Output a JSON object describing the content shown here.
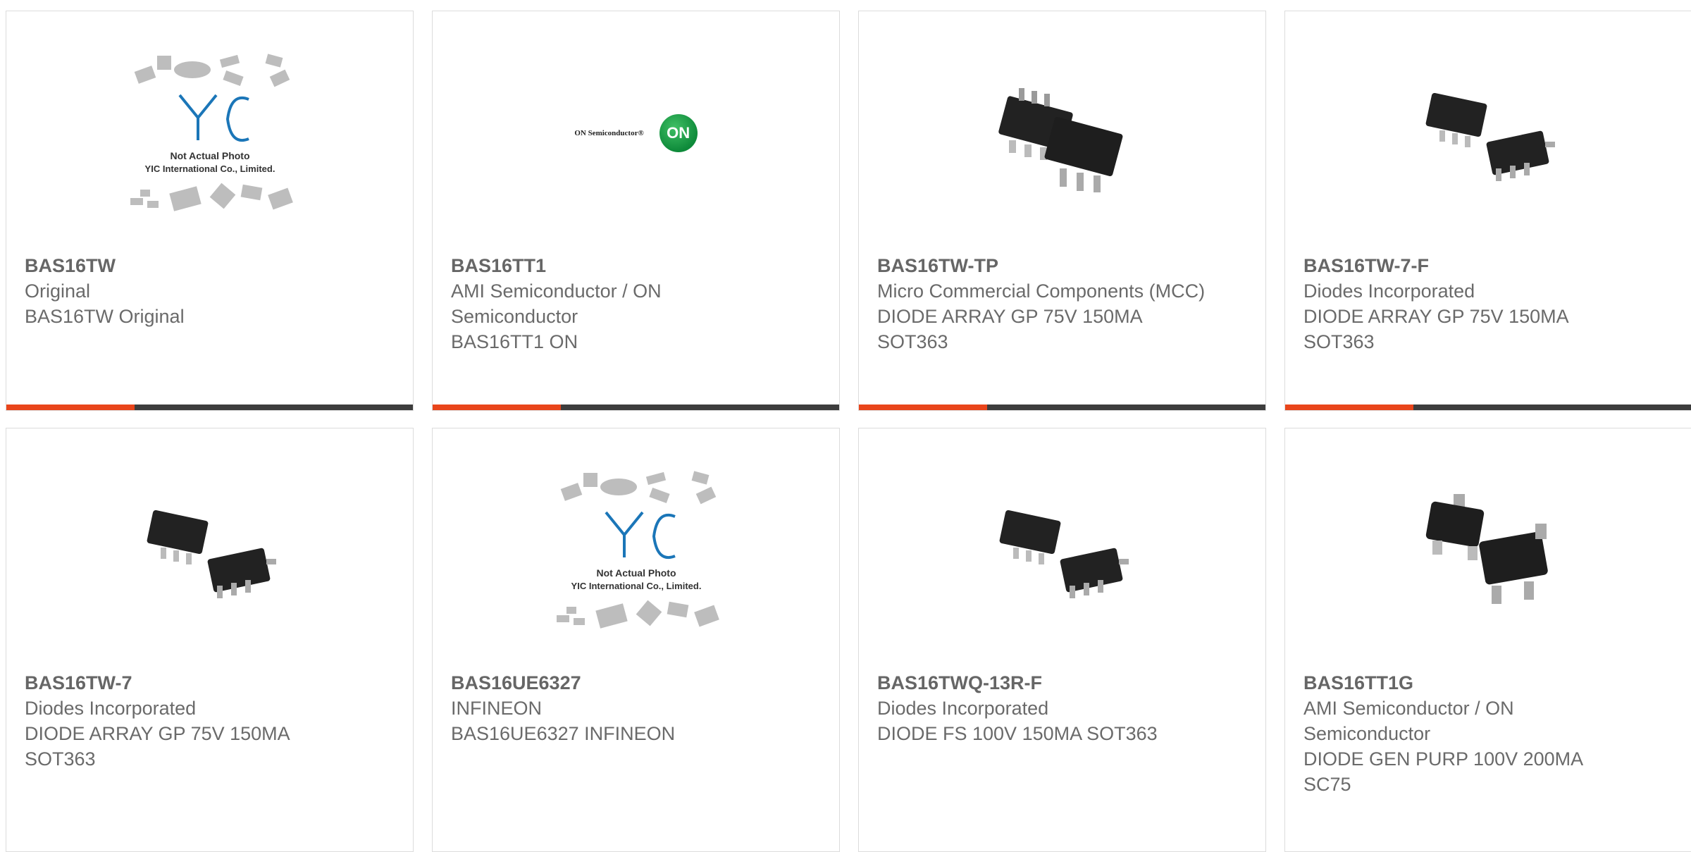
{
  "products": [
    {
      "part": "BAS16TW",
      "manufacturer": "Original",
      "description": "BAS16TW Original",
      "image": "not-actual-photo",
      "photo_text": [
        "Not Actual Photo",
        "YIC International Co., Limited."
      ]
    },
    {
      "part": "BAS16TT1",
      "manufacturer": "AMI Semiconductor / ON Semiconductor",
      "description": "BAS16TT1 ON",
      "image": "on-semiconductor-logo",
      "logo_text": "ON Semiconductor®",
      "logo_mark": "ON"
    },
    {
      "part": "BAS16TW-TP",
      "manufacturer": "Micro Commercial Components (MCC)",
      "description": "DIODE ARRAY GP 75V 150MA SOT363",
      "image": "sot363-package"
    },
    {
      "part": "BAS16TW-7-F",
      "manufacturer": "Diodes Incorporated",
      "description": "DIODE ARRAY GP 75V 150MA SOT363",
      "image": "sot363-package"
    },
    {
      "part": "BAS16TW-7",
      "manufacturer": "Diodes Incorporated",
      "description": "DIODE ARRAY GP 75V 150MA SOT363",
      "image": "sot363-package"
    },
    {
      "part": "BAS16UE6327",
      "manufacturer": "INFINEON",
      "description": "BAS16UE6327 INFINEON",
      "image": "not-actual-photo",
      "photo_text": [
        "Not Actual Photo",
        "YIC International Co., Limited."
      ]
    },
    {
      "part": "BAS16TWQ-13R-F",
      "manufacturer": "Diodes Incorporated",
      "description": "DIODE FS 100V 150MA SOT363",
      "image": "sot363-package"
    },
    {
      "part": "BAS16TT1G",
      "manufacturer": "AMI Semiconductor / ON Semiconductor",
      "description": "DIODE GEN PURP 100V 200MA SC75",
      "image": "sc75-package"
    }
  ],
  "colors": {
    "accent": "#e9451b",
    "bar": "#3d3d3d",
    "text": "#6a6a6a"
  }
}
